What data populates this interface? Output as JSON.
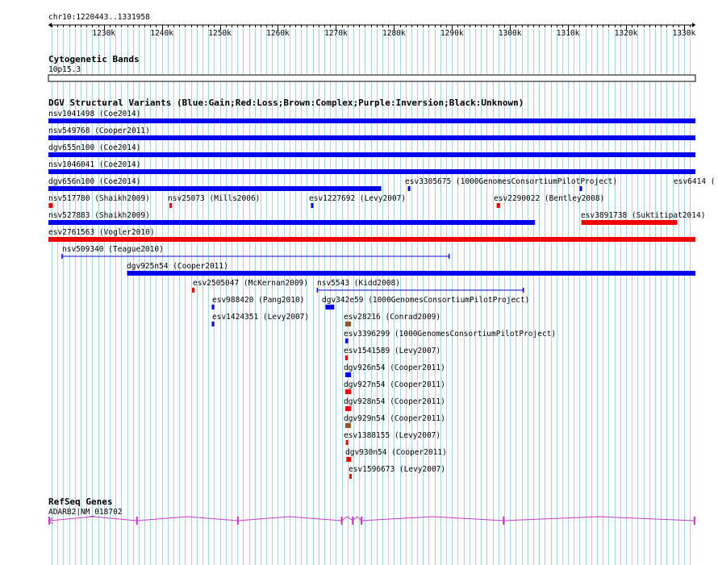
{
  "ruler": {
    "region": "chr10:1220443..1331958",
    "tick_labels": [
      "1230k",
      "1240k",
      "1250k",
      "1260k",
      "1270k",
      "1280k",
      "1290k",
      "1300k",
      "1310k",
      "1320k",
      "1330k"
    ]
  },
  "cytoband_track": {
    "title": "Cytogenetic Bands",
    "band_label": "10p15.3"
  },
  "dgv_track": {
    "title": "DGV Structural Variants (Blue:Gain;Red:Loss;Brown:Complex;Purple:Inversion;Black:Unknown)",
    "colors": {
      "gain": "#0000ee",
      "loss": "#ee0000",
      "complex": "#8b5a2b",
      "inversion": "#800080",
      "unknown": "#000000"
    },
    "features": [
      {
        "label": "nsv1041498 (Coe2014)",
        "type": "gain",
        "start": 1220443,
        "end": 1331958
      },
      {
        "label": "nsv549768 (Cooper2011)",
        "type": "gain",
        "start": 1220443,
        "end": 1331958
      },
      {
        "label": "dgv655n100 (Coe2014)",
        "type": "gain",
        "start": 1220443,
        "end": 1331958
      },
      {
        "label": "nsv1046041 (Coe2014)",
        "type": "gain",
        "start": 1220443,
        "end": 1331958
      },
      {
        "label": "dgv656n100 (Coe2014)",
        "type": "gain",
        "start": 1220443,
        "end": 1277800
      },
      {
        "label": "esv3305675 (1000GenomesConsortiumPilotProject)",
        "type": "gain",
        "start": 1282400,
        "end": 1282500
      },
      {
        "label": "esv6414 (",
        "type": "gain",
        "start": 1312000,
        "end": 1312300
      },
      {
        "label": "nsv517780 (Shaikh2009)",
        "type": "loss",
        "start": 1220500,
        "end": 1221200
      },
      {
        "label": "nsv25073 (Mills2006)",
        "type": "loss",
        "start": 1241300,
        "end": 1241500
      },
      {
        "label": "esv1227692 (Levy2007)",
        "type": "gain",
        "start": 1265700,
        "end": 1265900
      },
      {
        "label": "esv2290022 (Bentley2008)",
        "type": "loss",
        "start": 1297700,
        "end": 1298300
      },
      {
        "label": "nsv527883 (Shaikh2009)",
        "type": "gain",
        "start": 1220443,
        "end": 1304300
      },
      {
        "label": "esv3891738 (Suktitipat2014)",
        "type": "loss",
        "start": 1312300,
        "end": 1328800
      },
      {
        "label": "esv2761563 (Vogler2010)",
        "type": "loss",
        "start": 1220443,
        "end": 1331958
      },
      {
        "label": "nsv509340 (Teague2010)",
        "type": "unknown_line",
        "start": 1222800,
        "end": 1289500
      },
      {
        "label": "dgv925n54 (Cooper2011)",
        "type": "gain",
        "start": 1234000,
        "end": 1331958
      },
      {
        "label": "esv2505047 (McKernan2009)",
        "type": "loss",
        "start": 1245200,
        "end": 1245400
      },
      {
        "label": "nsv5543 (Kidd2008)",
        "type": "gain_line",
        "start": 1266800,
        "end": 1302300
      },
      {
        "label": "esv988420 (Pang2010)",
        "type": "gain",
        "start": 1248600,
        "end": 1248800
      },
      {
        "label": "dgv342e59 (1000GenomesConsortiumPilotProject)",
        "type": "gain",
        "start": 1268200,
        "end": 1269700
      },
      {
        "label": "esv1424351 (Levy2007)",
        "type": "gain",
        "start": 1248600,
        "end": 1248800
      },
      {
        "label": "esv28216 (Conrad2009)",
        "type": "complex",
        "start": 1271600,
        "end": 1272600
      },
      {
        "label": "esv3396299 (1000GenomesConsortiumPilotProject)",
        "type": "gain",
        "start": 1271600,
        "end": 1272100
      },
      {
        "label": "esv1541589 (Levy2007)",
        "type": "loss",
        "start": 1271600,
        "end": 1271800
      },
      {
        "label": "dgv926n54 (Cooper2011)",
        "type": "gain",
        "start": 1271600,
        "end": 1272600
      },
      {
        "label": "dgv927n54 (Cooper2011)",
        "type": "loss",
        "start": 1271600,
        "end": 1272600
      },
      {
        "label": "dgv928n54 (Cooper2011)",
        "type": "loss",
        "start": 1271600,
        "end": 1272600
      },
      {
        "label": "dgv929n54 (Cooper2011)",
        "type": "complex",
        "start": 1271600,
        "end": 1272600
      },
      {
        "label": "esv1388155 (Levy2007)",
        "type": "loss",
        "start": 1271700,
        "end": 1271900
      },
      {
        "label": "dgv930n54 (Cooper2011)",
        "type": "loss",
        "start": 1271800,
        "end": 1272600
      },
      {
        "label": "esv1596673 (Levy2007)",
        "type": "loss",
        "start": 1272300,
        "end": 1272500
      }
    ]
  },
  "refseq_track": {
    "title": "RefSeq Genes",
    "gene_label": "ADARB2|NM_018702",
    "color": "#cc33cc",
    "exons": [
      1220600,
      1235700,
      1253100,
      1271000,
      1272900,
      1274400,
      1298900,
      1331800
    ]
  }
}
